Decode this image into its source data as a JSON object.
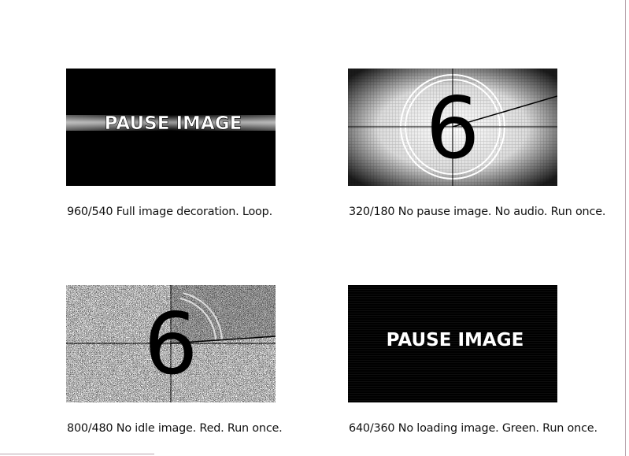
{
  "tiles": [
    {
      "image_kind": "pause-image",
      "image_text": "PAUSE IMAGE",
      "caption": "960/540 Full image decoration. Loop."
    },
    {
      "image_kind": "countdown-leader",
      "image_text": "6",
      "caption": "320/180 No pause image. No audio. Run once."
    },
    {
      "image_kind": "countdown-noise",
      "image_text": "6",
      "caption": "800/480 No idle image. Red. Run once."
    },
    {
      "image_kind": "pause-image",
      "image_text": "PAUSE IMAGE",
      "caption": "640/360 No loading image. Green. Run once."
    }
  ],
  "colors": {
    "border": "#b7a3ad",
    "caption_text": "#111111",
    "pause_background": "#000000",
    "pause_text": "#ffffff"
  }
}
